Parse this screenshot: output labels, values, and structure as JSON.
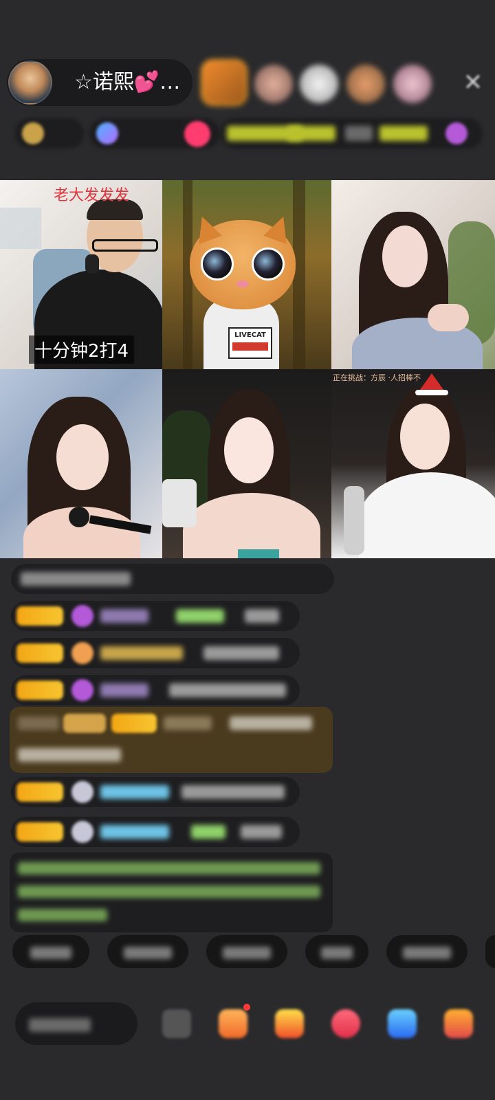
{
  "host": {
    "name_prefix": "☆诺熙",
    "heart": "💕",
    "ellipsis": "…"
  },
  "close_glyph": "✕",
  "video_tiles": [
    {
      "top_caption": "老大发发发",
      "bottom_caption": "十分钟2打4"
    },
    {},
    {},
    {},
    {},
    {
      "small_text": "正在挑战：方辰 ·人招棒不"
    }
  ],
  "cat_shirt_text": "LIVECAT",
  "colors": {
    "background": "#2a2a2c",
    "panel": "#1e1e20",
    "badge_gold": "#f3a614",
    "chat_green": "#8fd16a",
    "chat_blue": "#6ec3e6",
    "chat_purple": "#b45ad9",
    "highlight_brown": "#4a3a1e"
  },
  "icons": [
    "close-icon",
    "gift-icon",
    "bag-icon",
    "heart-icon",
    "game-icon",
    "more-icon"
  ]
}
